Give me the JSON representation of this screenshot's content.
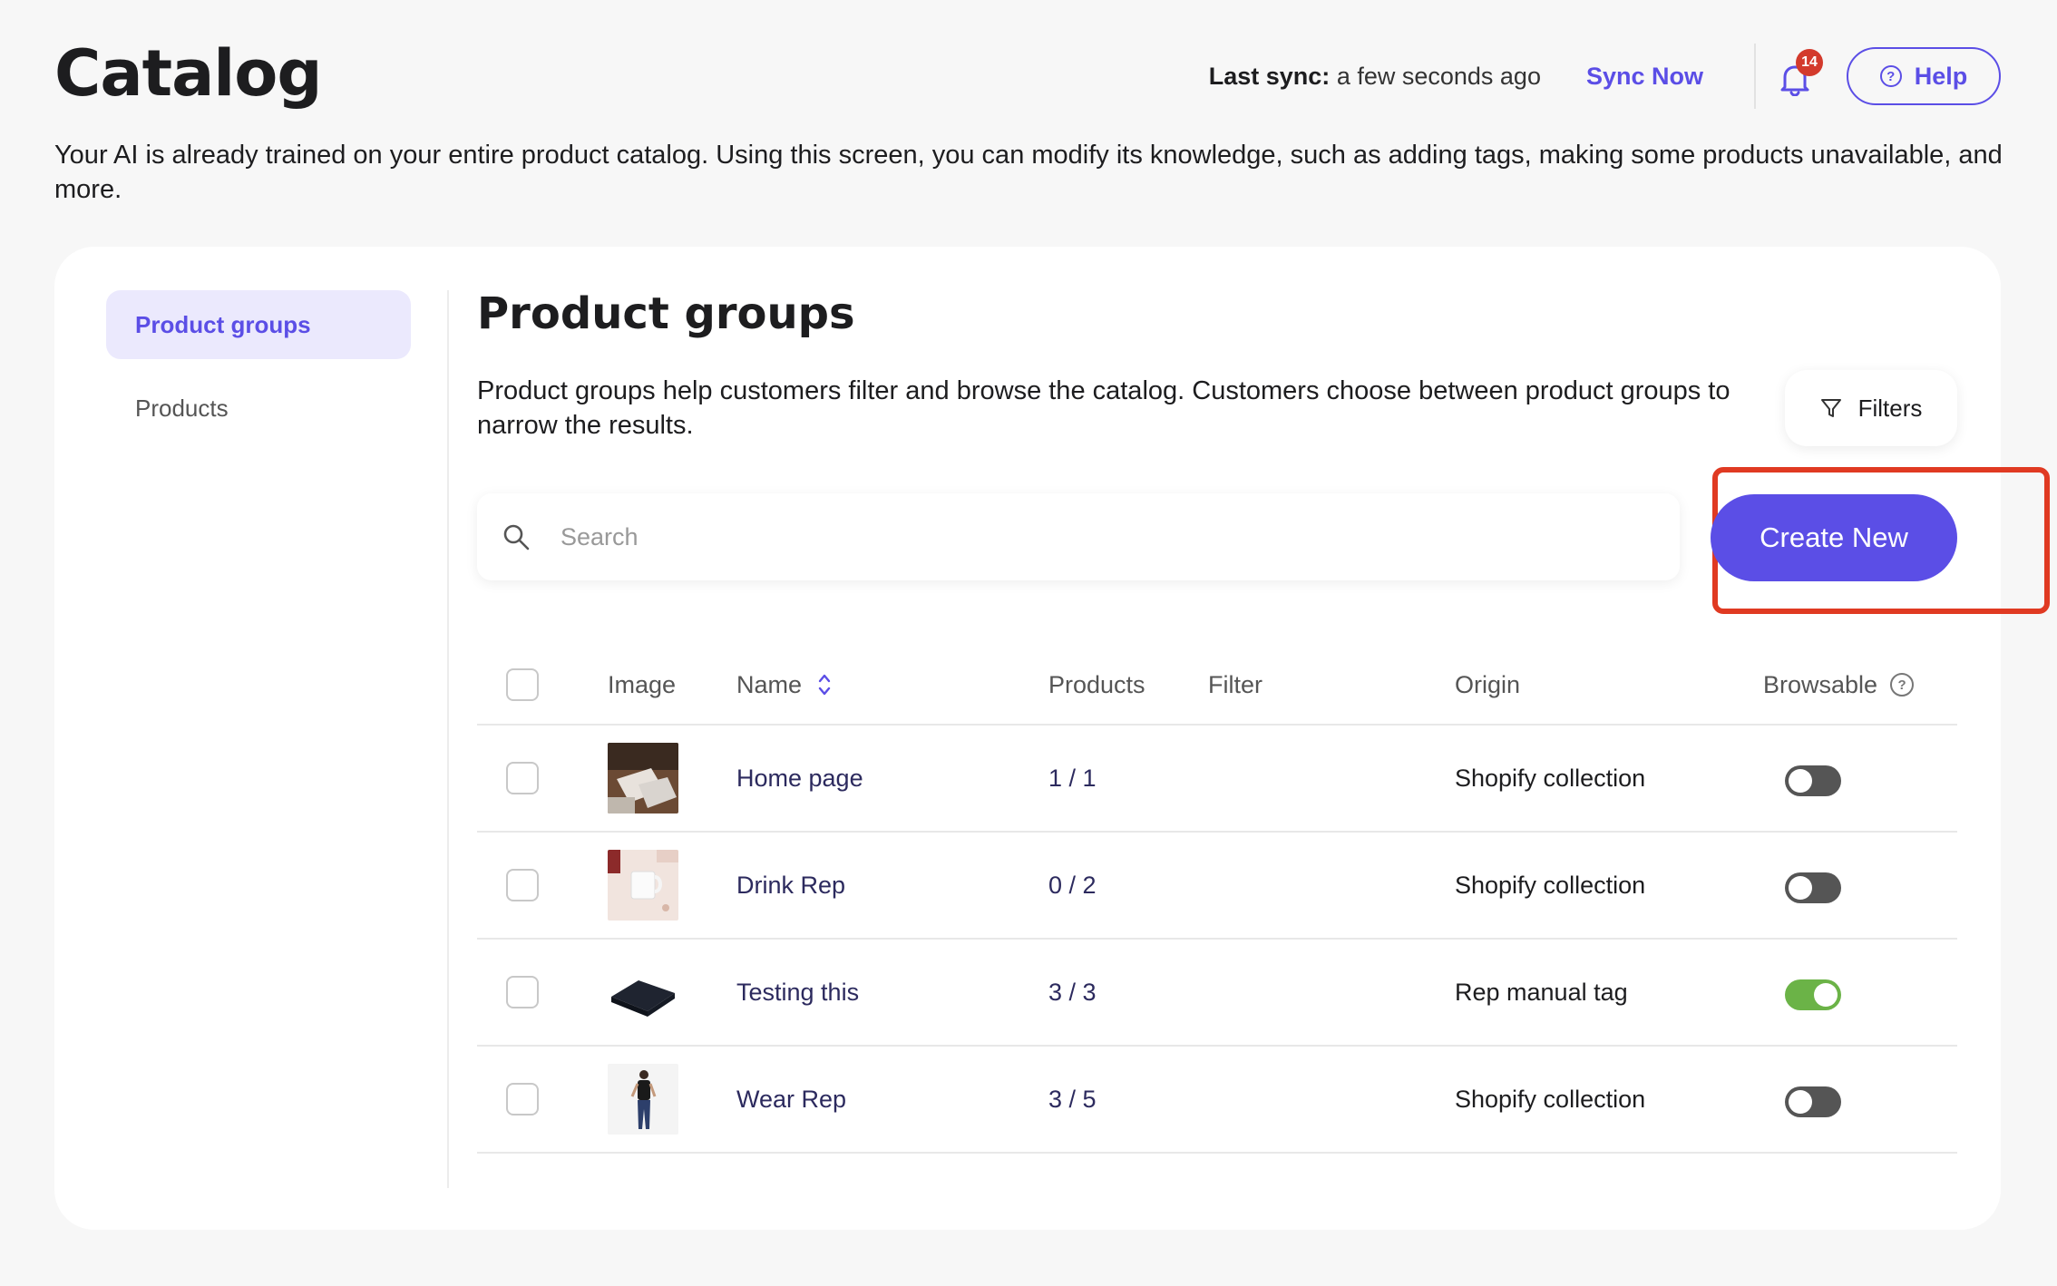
{
  "header": {
    "title": "Catalog",
    "last_sync_label": "Last sync:",
    "last_sync_value": "a few seconds ago",
    "sync_now_label": "Sync Now",
    "notification_count": "14",
    "help_label": "Help",
    "help_icon_glyph": "?"
  },
  "intro_text": "Your AI is already trained on your entire product catalog. Using this screen, you can modify its knowledge, such as adding tags, making some products unavailable, and more.",
  "sidebar": {
    "items": [
      {
        "label": "Product groups"
      },
      {
        "label": "Products"
      }
    ]
  },
  "main": {
    "title": "Product groups",
    "description": "Product groups help customers filter and browse the catalog. Customers choose between product groups to narrow the results.",
    "filters_label": "Filters",
    "search_placeholder": "Search",
    "create_new_label": "Create New"
  },
  "table": {
    "columns": {
      "image": "Image",
      "name": "Name",
      "products": "Products",
      "filter": "Filter",
      "origin": "Origin",
      "browsable": "Browsable",
      "browsable_info_glyph": "?"
    },
    "rows": [
      {
        "name": "Home page",
        "products": "1 / 1",
        "filter": "",
        "origin": "Shopify collection",
        "browsable": false,
        "image_icon": "pillows-photo-icon"
      },
      {
        "name": "Drink Rep",
        "products": "0 / 2",
        "filter": "",
        "origin": "Shopify collection",
        "browsable": false,
        "image_icon": "mug-photo-icon"
      },
      {
        "name": "Testing this",
        "products": "3 / 3",
        "filter": "",
        "origin": "Rep manual tag",
        "browsable": true,
        "image_icon": "wallet-photo-icon"
      },
      {
        "name": "Wear Rep",
        "products": "3 / 5",
        "filter": "",
        "origin": "Shopify collection",
        "browsable": false,
        "image_icon": "model-photo-icon"
      }
    ]
  },
  "colors": {
    "accent": "#5b4ee6",
    "highlight": "#e03a22",
    "toggle_on": "#6bb347",
    "toggle_off": "#555555",
    "badge": "#d33a2c"
  }
}
